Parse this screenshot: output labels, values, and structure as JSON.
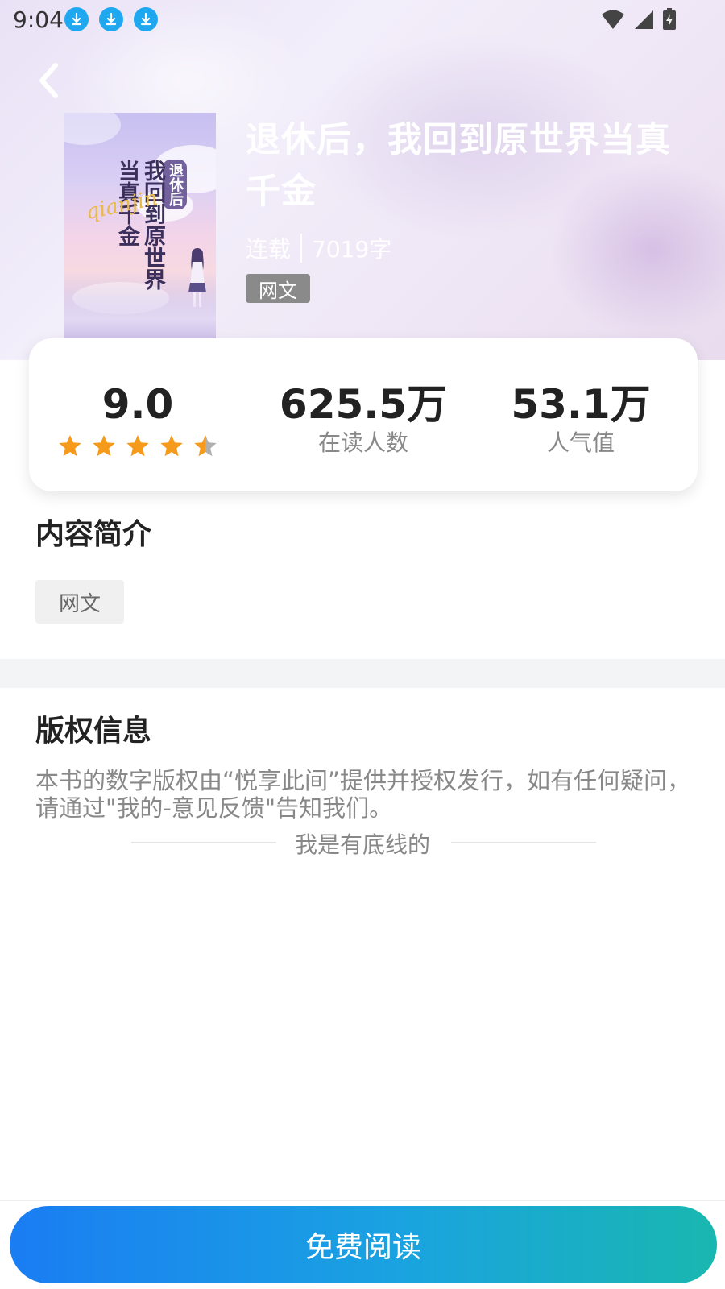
{
  "status_bar": {
    "time": "9:04"
  },
  "book": {
    "title": "退休后，我回到原世界当真千金",
    "status": "连载",
    "word_count": "7019字",
    "genre": "网文",
    "cover_text": {
      "line1": "退休后",
      "line2": "我回到原世界",
      "line3": "当真千金",
      "script": "qianjin"
    }
  },
  "stats": {
    "rating": {
      "value": "9.0",
      "stars": 4.5
    },
    "readers": {
      "value": "625.5万",
      "label": "在读人数"
    },
    "popularity": {
      "value": "53.1万",
      "label": "人气值"
    }
  },
  "intro": {
    "title": "内容简介",
    "tag": "网文"
  },
  "copyright": {
    "title": "版权信息",
    "text": "本书的数字版权由“悦享此间”提供并授权发行，如有任何疑问，请通过\"我的-意见反馈\"告知我们。"
  },
  "footer_note": "我是有底线的",
  "read_button": {
    "label": "免费阅读"
  },
  "colors": {
    "accent_start": "#1a7df3",
    "accent_end": "#19b7b0",
    "star": "#f59a1b"
  }
}
